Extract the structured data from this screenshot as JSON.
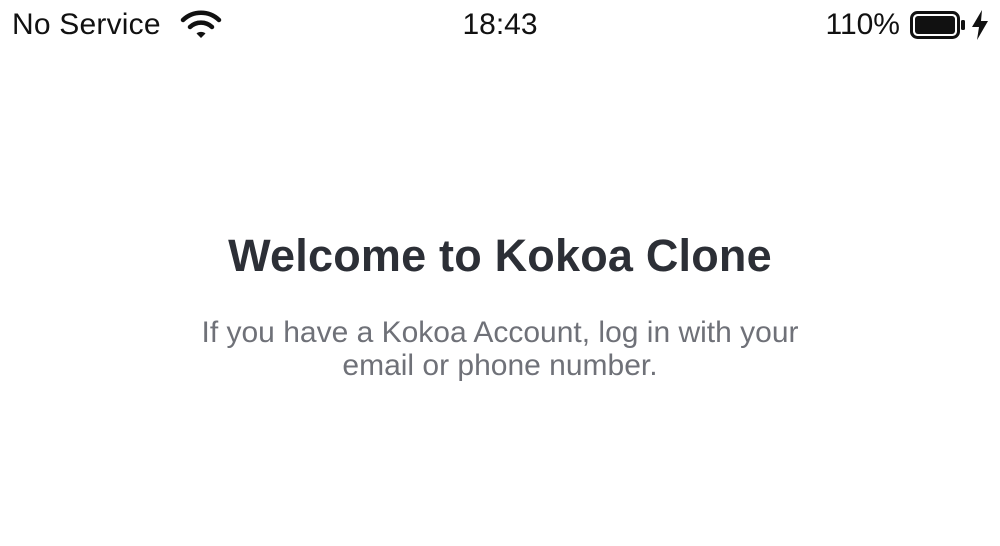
{
  "status_bar": {
    "carrier": "No Service",
    "time": "18:43",
    "battery_percent": "110%",
    "icons": [
      "wifi-icon",
      "battery-icon",
      "charging-bolt-icon"
    ]
  },
  "welcome": {
    "title": "Welcome to Kokoa Clone",
    "subtitle": "If you have a Kokoa Account, log in with your email or phone number."
  },
  "colors": {
    "background": "#ffffff",
    "title": "#2c2f36",
    "subtitle": "#6f7178",
    "status_text": "#111111"
  }
}
